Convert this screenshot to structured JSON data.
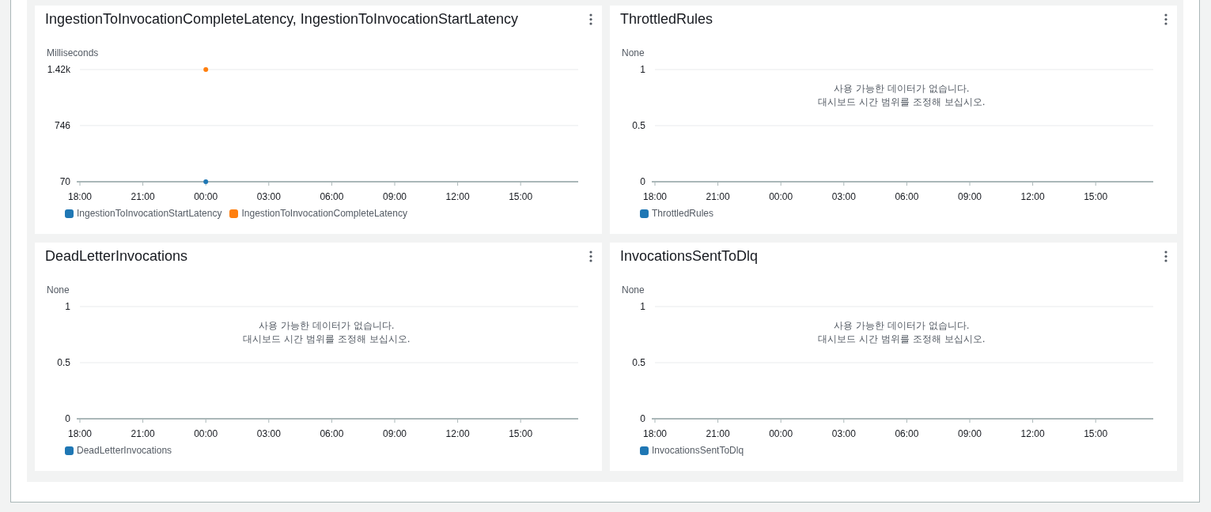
{
  "widgets": [
    {
      "title": "IngestionToInvocationCompleteLatency, IngestionToInvocationStartLatency",
      "chart_data": {
        "type": "scatter",
        "ylabel": "Milliseconds",
        "categories": [
          "18:00",
          "21:00",
          "00:00",
          "03:00",
          "06:00",
          "09:00",
          "12:00",
          "15:00"
        ],
        "ylim": [
          70,
          1420
        ],
        "yticks": [
          {
            "value": 70,
            "label": "70"
          },
          {
            "value": 746,
            "label": "746"
          },
          {
            "value": 1420,
            "label": "1.42k"
          }
        ],
        "series": [
          {
            "name": "IngestionToInvocationStartLatency",
            "color": "#1f77b4",
            "values": [
              null,
              null,
              70,
              null,
              null,
              null,
              null,
              null
            ]
          },
          {
            "name": "IngestionToInvocationCompleteLatency",
            "color": "#ff7f0e",
            "values": [
              null,
              null,
              1420,
              null,
              null,
              null,
              null,
              null
            ]
          }
        ]
      }
    },
    {
      "title": "ThrottledRules",
      "no_data_message": [
        "사용 가능한 데이터가 없습니다.",
        "대시보드 시간 범위를 조정해 보십시오."
      ],
      "chart_data": {
        "type": "line",
        "ylabel": "None",
        "categories": [
          "18:00",
          "21:00",
          "00:00",
          "03:00",
          "06:00",
          "09:00",
          "12:00",
          "15:00"
        ],
        "ylim": [
          0,
          1
        ],
        "yticks": [
          {
            "value": 0,
            "label": "0"
          },
          {
            "value": 0.5,
            "label": "0.5"
          },
          {
            "value": 1,
            "label": "1"
          }
        ],
        "series": [
          {
            "name": "ThrottledRules",
            "color": "#1f77b4",
            "values": [
              null,
              null,
              null,
              null,
              null,
              null,
              null,
              null
            ]
          }
        ]
      }
    },
    {
      "title": "DeadLetterInvocations",
      "no_data_message": [
        "사용 가능한 데이터가 없습니다.",
        "대시보드 시간 범위를 조정해 보십시오."
      ],
      "chart_data": {
        "type": "line",
        "ylabel": "None",
        "categories": [
          "18:00",
          "21:00",
          "00:00",
          "03:00",
          "06:00",
          "09:00",
          "12:00",
          "15:00"
        ],
        "ylim": [
          0,
          1
        ],
        "yticks": [
          {
            "value": 0,
            "label": "0"
          },
          {
            "value": 0.5,
            "label": "0.5"
          },
          {
            "value": 1,
            "label": "1"
          }
        ],
        "series": [
          {
            "name": "DeadLetterInvocations",
            "color": "#1f77b4",
            "values": [
              null,
              null,
              null,
              null,
              null,
              null,
              null,
              null
            ]
          }
        ]
      }
    },
    {
      "title": "InvocationsSentToDlq",
      "no_data_message": [
        "사용 가능한 데이터가 없습니다.",
        "대시보드 시간 범위를 조정해 보십시오."
      ],
      "chart_data": {
        "type": "line",
        "ylabel": "None",
        "categories": [
          "18:00",
          "21:00",
          "00:00",
          "03:00",
          "06:00",
          "09:00",
          "12:00",
          "15:00"
        ],
        "ylim": [
          0,
          1
        ],
        "yticks": [
          {
            "value": 0,
            "label": "0"
          },
          {
            "value": 0.5,
            "label": "0.5"
          },
          {
            "value": 1,
            "label": "1"
          }
        ],
        "series": [
          {
            "name": "InvocationsSentToDlq",
            "color": "#1f77b4",
            "values": [
              null,
              null,
              null,
              null,
              null,
              null,
              null,
              null
            ]
          }
        ]
      }
    }
  ]
}
